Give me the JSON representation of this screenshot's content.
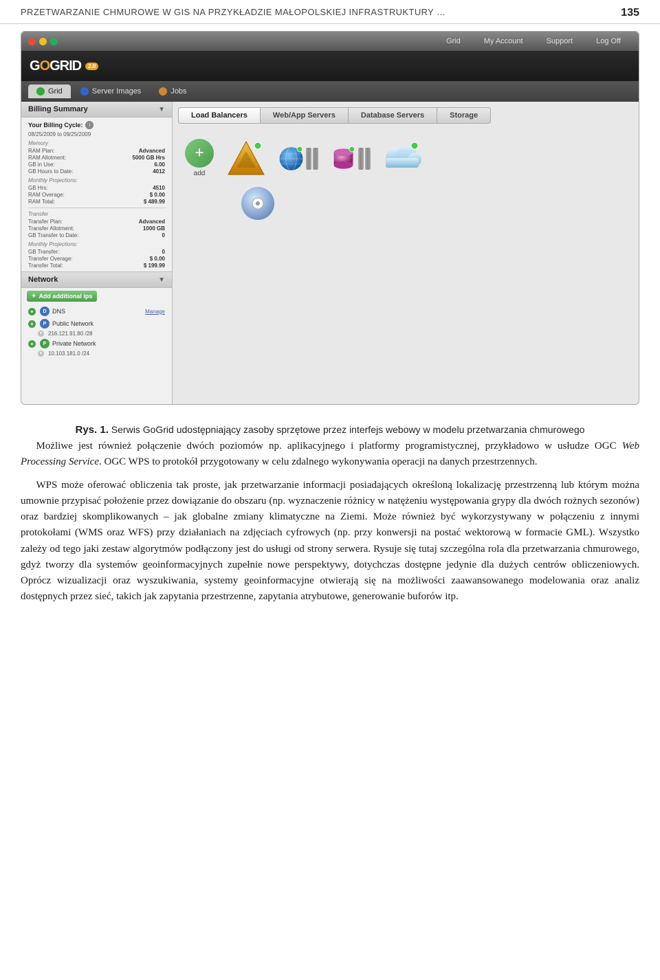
{
  "page": {
    "header_title": "PRZETWARZANIE CHMUROWE W GIS NA PRZYKŁADZIE MAŁOPOLSKIEJ INFRASTRUKTURY …",
    "page_number": "135"
  },
  "app": {
    "logo": "GOGRID",
    "logo_version": "2.0",
    "nav_top": [
      "Grid",
      "My Account",
      "Support",
      "Log Off"
    ],
    "main_tabs": [
      "Grid",
      "Server Images",
      "Jobs"
    ],
    "active_tab": "Grid",
    "server_tabs": [
      "Load Balancers",
      "Web/App Servers",
      "Database Servers",
      "Storage"
    ],
    "add_label": "add"
  },
  "billing": {
    "section_title": "Billing Summary",
    "cycle_label": "Your Billing Cycle:",
    "cycle_dates": "08/25/2009 to 09/25/2009",
    "memory_title": "Memory",
    "ram_plan_label": "RAM Plan:",
    "ram_plan_value": "Advanced",
    "ram_allotment_label": "RAM Allotment:",
    "ram_allotment_value": "5000 GB Hrs",
    "gb_in_use_label": "GB in Use:",
    "gb_in_use_value": "6.00",
    "gb_hours_label": "GB Hours to Date:",
    "gb_hours_value": "4012",
    "monthly_proj_label": "Monthly Projections:",
    "gb_hrs_label": "GB Hrs:",
    "gb_hrs_value": "4510",
    "ram_overage_label": "RAM Overage:",
    "ram_overage_value": "$ 0.00",
    "ram_total_label": "RAM Total:",
    "ram_total_value": "$ 489.99",
    "transfer_title": "Transfer",
    "transfer_plan_label": "Transfer Plan:",
    "transfer_plan_value": "Advanced",
    "transfer_allot_label": "Transfer Allotment:",
    "transfer_allot_value": "1000 GB",
    "gb_transfer_date_label": "GB Transfer to Date:",
    "gb_transfer_date_value": "0",
    "monthly_proj2_label": "Monthly Projections:",
    "gb_transfer_label": "GB Transfer:",
    "gb_transfer_value": "0",
    "transfer_overage_label": "Transfer Overage:",
    "transfer_overage_value": "$ 0.00",
    "transfer_total_label": "Transfer Total:",
    "transfer_total_value": "$ 199.99"
  },
  "network": {
    "section_title": "Network",
    "add_ips_label": "Add additional ips",
    "dns_label": "DNS",
    "dns_manage": "Manage",
    "public_network_label": "Public Network",
    "public_ip": "216.121.91.80 /28",
    "private_network_label": "Private Network",
    "private_ip": "10.103.181.0 /24"
  },
  "caption": {
    "figure_ref": "Rys. 1.",
    "text": "Serwis GoGrid udostępniający zasoby sprzętowe przez interfejs webowy w modelu przetwarzania chmurowego"
  },
  "body_paragraphs": [
    "Możliwe jest również połączenie dwóch poziomów np. aplikacyjnego i platformy programistycznej, przykładowo w usłudze OGC Web Processing Service. OGC WPS to protokół przygotowany w celu zdalnego wykonywania operacji na danych przestrzennych.",
    "WPS może oferować obliczenia tak proste, jak przetwarzanie informacji posiadających określoną lokalizację przestrzenną lub którym można umownie przypisać położenie przez dowiązanie do obszaru (np. wyznaczenie różnicy w natężeniu występowania grypy dla dwóch rożnych sezonów) oraz bardziej skomplikowanych – jak globalne zmiany klimatyczne na Ziemi. Może również być wykorzystywany w połączeniu z innymi protokołami (WMS oraz WFS) przy działaniach na zdjęciach cyfrowych (np. przy konwersji na postać wektorową w formacie GML). Wszystko zależy od tego jaki zestaw algorytmów podłączony jest do usługi od strony serwera. Rysuje się tutaj szczególna rola dla przetwarzania chmurowego, gdyż tworzy dla systemów geoinformacyjnych zupełnie nowe perspektywy, dotychczas dostępne jedynie dla dużych centrów obliczeniowych. Oprócz wizualizacji oraz wyszukiwania, systemy geoinformacyjne otwierają się na możliwości zaawansowanego modelowania oraz analiz dostępnych przez sieć, takich jak zapytania przestrzenne, zapytania atrybutowe, generowanie buforów itp."
  ]
}
